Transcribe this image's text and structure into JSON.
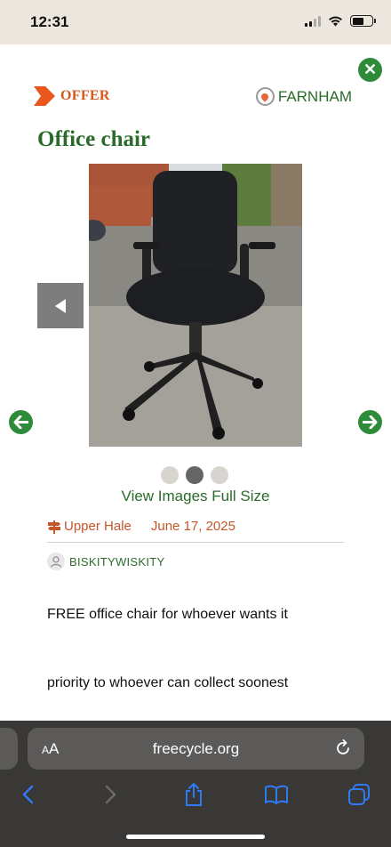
{
  "status_bar": {
    "time": "12:31"
  },
  "post": {
    "type_label": "OFFER",
    "location": "FARNHAM",
    "title": "Office chair",
    "view_full_size": "View Images Full Size",
    "area": "Upper Hale",
    "date": "June 17, 2025",
    "username": "BISKITYWISKITY",
    "description_line1": "FREE office chair for whoever wants it",
    "description_line2": "priority to whoever can collect soonest"
  },
  "carousel": {
    "image_count": 3,
    "active_index": 1
  },
  "browser": {
    "text_size_label": "AA",
    "url": "freecycle.org"
  },
  "colors": {
    "green": "#2a6b2a",
    "orange": "#d4591c",
    "button_green": "#2e8b3a"
  },
  "icons": [
    "close-icon",
    "offer-arrow-icon",
    "location-pin-icon",
    "chevron-left-icon",
    "arrow-left-circle-icon",
    "arrow-right-circle-icon",
    "signpost-icon",
    "user-avatar-icon",
    "reload-icon",
    "back-icon",
    "forward-icon",
    "share-icon",
    "bookmarks-icon",
    "tabs-icon"
  ]
}
